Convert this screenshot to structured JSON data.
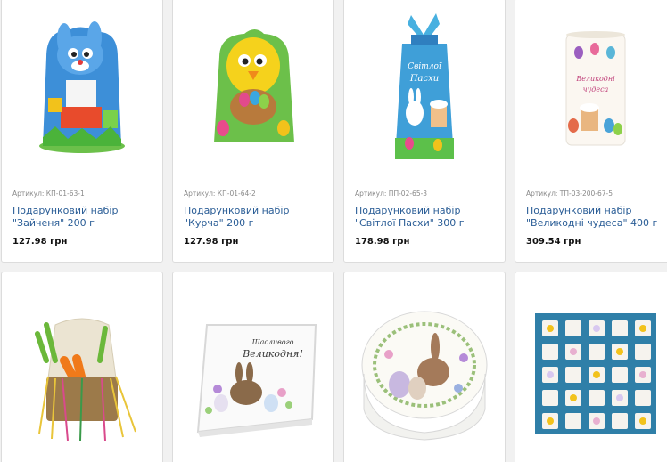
{
  "products": [
    {
      "sku": "Артикул: КП-01-63-1",
      "title": "Подарунковий набір \"Зайченя\" 200 г",
      "price": "127.98 грн",
      "icon": "bunny-box-image"
    },
    {
      "sku": "Артикул: КП-01-64-2",
      "title": "Подарунковий набір \"Курча\" 200 г",
      "price": "127.98 грн",
      "icon": "chick-box-image"
    },
    {
      "sku": "Артикул: ПП-02-65-3",
      "title": "Подарунковий набір \"Світлої Пасхи\" 300 г",
      "price": "178.98 грн",
      "icon": "easter-bag-image"
    },
    {
      "sku": "Артикул: ТП-03-200-67-5",
      "title": "Подарунковий набір \"Великодні чудеса\" 400 г",
      "price": "309.54 грн",
      "icon": "easter-tube-image"
    }
  ],
  "bottom_products": [
    {
      "icon": "burlap-sack-image"
    },
    {
      "icon": "square-tin-image",
      "caption_line1": "Щасливого",
      "caption_line2": "Великодня!"
    },
    {
      "icon": "oval-tin-image"
    },
    {
      "icon": "advent-box-image"
    }
  ],
  "colors": {
    "link": "#2a5d96",
    "price": "#111111",
    "sku": "#8a8a8a",
    "card_border": "#dcdcdc",
    "page_bg": "#f1f1f1"
  }
}
